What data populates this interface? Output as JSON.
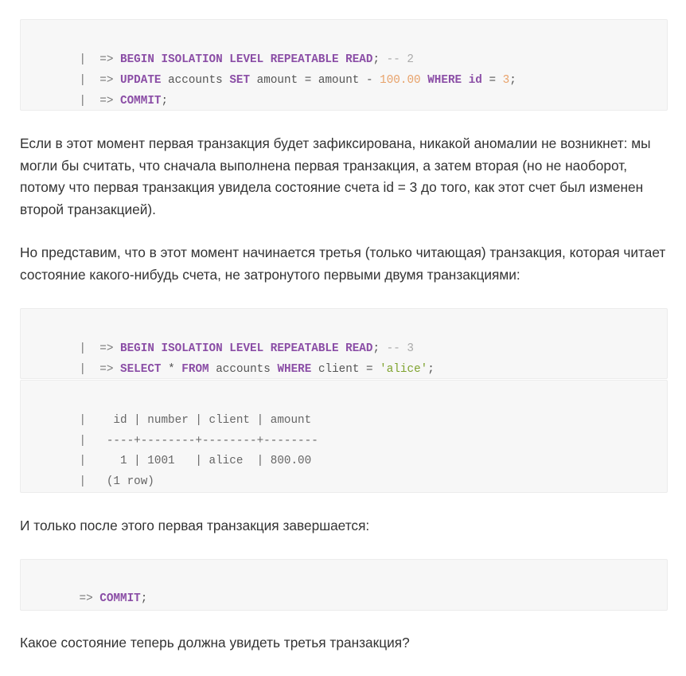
{
  "block1": {
    "line1": {
      "pipe": "|",
      "prompt": "=>",
      "kw1": "BEGIN ISOLATION LEVEL REPEATABLE READ",
      "semi": ";",
      "comment": "-- 2"
    },
    "line2": {
      "pipe": "|",
      "prompt": "=>",
      "kw1": "UPDATE",
      "t1": "accounts",
      "kw2": "SET",
      "t2": "amount = amount -",
      "num1": "100.00",
      "kw3": "WHERE",
      "kw4": "id",
      "t3": "=",
      "num2": "3",
      "semi": ";"
    },
    "line3": {
      "pipe": "|",
      "prompt": "=>",
      "kw1": "COMMIT",
      "semi": ";"
    }
  },
  "para1": "Если в этот момент первая транзакция будет зафиксирована, никакой аномалии не возникнет: мы могли бы считать, что сначала выполнена первая транзакция, а затем вторая (но не наоборот, потому что первая транзакция увидела состояние счета id = 3 до того, как этот счет был изменен второй транзакцией).",
  "para2": "Но представим, что в этот момент начинается третья (только читающая) транзакция, которая читает состояние какого-нибудь счета, не затронутого первыми двумя транзакциями:",
  "block2": {
    "line1": {
      "pipe": "|",
      "prompt": "=>",
      "kw1": "BEGIN ISOLATION LEVEL REPEATABLE READ",
      "semi": ";",
      "comment": "-- 3"
    },
    "line2": {
      "pipe": "|",
      "prompt": "=>",
      "kw1": "SELECT",
      "t1": "*",
      "kw2": "FROM",
      "t2": "accounts",
      "kw3": "WHERE",
      "t3": "client =",
      "str1": "'alice'",
      "semi": ";"
    }
  },
  "block3": {
    "lines": [
      {
        "pipe": "|",
        "text": "  id | number | client | amount"
      },
      {
        "pipe": "|",
        "text": " ----+--------+--------+--------"
      },
      {
        "pipe": "|",
        "text": "   1 | 1001   | alice  | 800.00"
      },
      {
        "pipe": "|",
        "text": " (1 row)"
      }
    ]
  },
  "para3": "И только после этого первая транзакция завершается:",
  "block4": {
    "line1": {
      "prompt": "=>",
      "kw1": "COMMIT",
      "semi": ";"
    }
  },
  "para4": "Какое состояние теперь должна увидеть третья транзакция?",
  "colors": {
    "keyword": "#8b4ea6",
    "number": "#e8a26a",
    "string": "#7fa32e",
    "comment": "#aaaaaa",
    "code_bg": "#f7f7f7",
    "text": "#333333"
  }
}
